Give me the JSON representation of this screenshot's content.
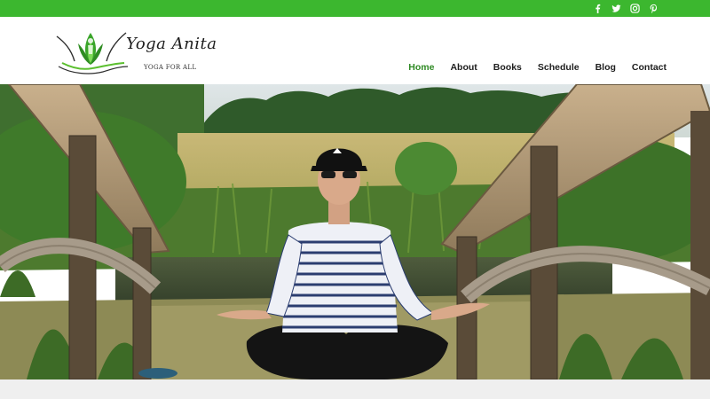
{
  "brand": {
    "name": "Yoga Anita",
    "tagline": "YOGA FOR ALL",
    "accent_color": "#3cb72f"
  },
  "social": [
    {
      "icon": "facebook-icon"
    },
    {
      "icon": "twitter-icon"
    },
    {
      "icon": "instagram-icon"
    },
    {
      "icon": "pinterest-icon"
    }
  ],
  "nav": {
    "items": [
      {
        "label": "Home",
        "active": true
      },
      {
        "label": "About"
      },
      {
        "label": "Books"
      },
      {
        "label": "Schedule"
      },
      {
        "label": "Blog"
      },
      {
        "label": "Contact"
      }
    ]
  },
  "hero": {
    "image_alt": "Woman in striped shirt and black cap meditating cross-legged on a wooden footbridge by a pond"
  }
}
